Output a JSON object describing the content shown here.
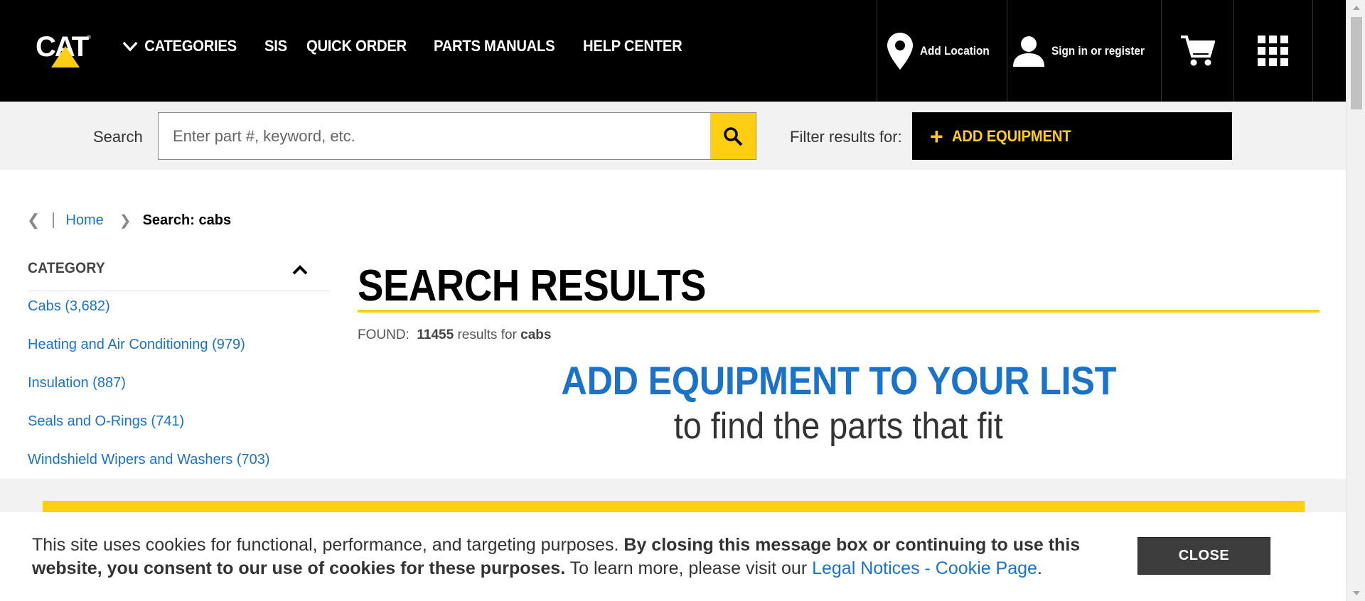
{
  "header": {
    "logo_text": "CAT",
    "nav": [
      {
        "label": "CATEGORIES"
      },
      {
        "label": "SIS"
      },
      {
        "label": "QUICK ORDER"
      },
      {
        "label": "PARTS MANUALS"
      },
      {
        "label": "HELP CENTER"
      }
    ],
    "add_location": "Add Location",
    "sign_in": "Sign in or register",
    "icons": {
      "location": "location-pin-icon",
      "user": "user-icon",
      "cart": "cart-icon",
      "apps": "apps-grid-icon"
    }
  },
  "search": {
    "label": "Search",
    "placeholder": "Enter part #, keyword, etc.",
    "value": "",
    "filter_label": "Filter results for:",
    "add_equipment": "ADD EQUIPMENT"
  },
  "breadcrumb": {
    "home": "Home",
    "current": "Search: cabs"
  },
  "sidebar": {
    "title": "CATEGORY",
    "items": [
      {
        "label": "Cabs (3,682)"
      },
      {
        "label": "Heating and Air Conditioning (979)"
      },
      {
        "label": "Insulation (887)"
      },
      {
        "label": "Seals and O-Rings (741)"
      },
      {
        "label": "Windshield Wipers and Washers (703)"
      }
    ]
  },
  "main": {
    "title": "SEARCH RESULTS",
    "found_prefix": "FOUND:",
    "found_count": "11455",
    "found_mid": "results for",
    "found_query": "cabs",
    "promo_heading": "ADD EQUIPMENT TO YOUR LIST",
    "promo_sub": "to find the parts that fit"
  },
  "cookie": {
    "text_plain": "This site uses cookies for functional, performance, and targeting purposes.",
    "text_bold": "By closing this message box or continuing to use this website, you consent to our use of cookies for these purposes.",
    "text_tail": "To learn more, please visit our",
    "link": "Legal Notices - Cookie Page",
    "period": ".",
    "close": "CLOSE"
  },
  "colors": {
    "brand_yellow": "#ffcd11",
    "link_blue": "#1a73c9",
    "header_black": "#000000"
  }
}
